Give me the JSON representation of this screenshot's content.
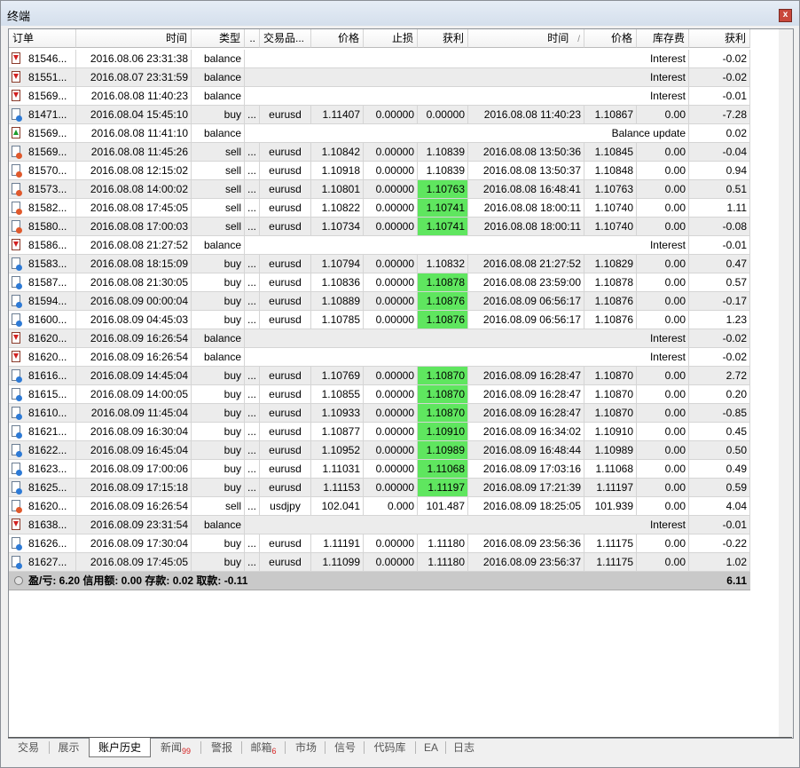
{
  "window": {
    "title": "终端",
    "close_label": "x"
  },
  "columns": [
    "订单",
    "时间",
    "类型",
    "..",
    "交易品...",
    "价格",
    "止损",
    "获利",
    "时间",
    "价格",
    "库存费",
    "获利"
  ],
  "sort_indicator": "/",
  "rows": [
    {
      "kind": "bal",
      "order": "81546...",
      "time": "2016.08.06 23:31:38",
      "type": "balance",
      "comment": "Interest",
      "profit": "-0.02"
    },
    {
      "kind": "bal",
      "order": "81551...",
      "time": "2016.08.07 23:31:59",
      "type": "balance",
      "comment": "Interest",
      "profit": "-0.02"
    },
    {
      "kind": "bal",
      "order": "81569...",
      "time": "2016.08.08 11:40:23",
      "type": "balance",
      "comment": "Interest",
      "profit": "-0.01"
    },
    {
      "kind": "trade",
      "order": "81471...",
      "time": "2016.08.04 15:45:10",
      "type": "buy",
      "dots": "...",
      "symbol": "eurusd",
      "price": "1.11407",
      "sl": "0.00000",
      "tp": "0.00000",
      "close_time": "2016.08.08 11:40:23",
      "close_price": "1.10867",
      "swap": "0.00",
      "profit": "-7.28"
    },
    {
      "kind": "bal-up",
      "order": "81569...",
      "time": "2016.08.08 11:41:10",
      "type": "balance",
      "comment": "Balance update",
      "profit": "0.02"
    },
    {
      "kind": "trade-sell",
      "order": "81569...",
      "time": "2016.08.08 11:45:26",
      "type": "sell",
      "dots": "...",
      "symbol": "eurusd",
      "price": "1.10842",
      "sl": "0.00000",
      "tp": "1.10839",
      "close_time": "2016.08.08 13:50:36",
      "close_price": "1.10845",
      "swap": "0.00",
      "profit": "-0.04"
    },
    {
      "kind": "trade-sell",
      "order": "81570...",
      "time": "2016.08.08 12:15:02",
      "type": "sell",
      "dots": "...",
      "symbol": "eurusd",
      "price": "1.10918",
      "sl": "0.00000",
      "tp": "1.10839",
      "close_time": "2016.08.08 13:50:37",
      "close_price": "1.10848",
      "swap": "0.00",
      "profit": "0.94"
    },
    {
      "kind": "trade-sell",
      "order": "81573...",
      "time": "2016.08.08 14:00:02",
      "type": "sell",
      "dots": "...",
      "symbol": "eurusd",
      "price": "1.10801",
      "sl": "0.00000",
      "tp": "1.10763",
      "tp_hit": true,
      "close_time": "2016.08.08 16:48:41",
      "close_price": "1.10763",
      "swap": "0.00",
      "profit": "0.51"
    },
    {
      "kind": "trade-sell",
      "order": "81582...",
      "time": "2016.08.08 17:45:05",
      "type": "sell",
      "dots": "...",
      "symbol": "eurusd",
      "price": "1.10822",
      "sl": "0.00000",
      "tp": "1.10741",
      "tp_hit": true,
      "close_time": "2016.08.08 18:00:11",
      "close_price": "1.10740",
      "swap": "0.00",
      "profit": "1.11"
    },
    {
      "kind": "trade-sell",
      "order": "81580...",
      "time": "2016.08.08 17:00:03",
      "type": "sell",
      "dots": "...",
      "symbol": "eurusd",
      "price": "1.10734",
      "sl": "0.00000",
      "tp": "1.10741",
      "tp_hit": true,
      "close_time": "2016.08.08 18:00:11",
      "close_price": "1.10740",
      "swap": "0.00",
      "profit": "-0.08"
    },
    {
      "kind": "bal",
      "order": "81586...",
      "time": "2016.08.08 21:27:52",
      "type": "balance",
      "comment": "Interest",
      "profit": "-0.01"
    },
    {
      "kind": "trade",
      "order": "81583...",
      "time": "2016.08.08 18:15:09",
      "type": "buy",
      "dots": "...",
      "symbol": "eurusd",
      "price": "1.10794",
      "sl": "0.00000",
      "tp": "1.10832",
      "close_time": "2016.08.08 21:27:52",
      "close_price": "1.10829",
      "swap": "0.00",
      "profit": "0.47"
    },
    {
      "kind": "trade",
      "order": "81587...",
      "time": "2016.08.08 21:30:05",
      "type": "buy",
      "dots": "...",
      "symbol": "eurusd",
      "price": "1.10836",
      "sl": "0.00000",
      "tp": "1.10878",
      "tp_hit": true,
      "close_time": "2016.08.08 23:59:00",
      "close_price": "1.10878",
      "swap": "0.00",
      "profit": "0.57"
    },
    {
      "kind": "trade",
      "order": "81594...",
      "time": "2016.08.09 00:00:04",
      "type": "buy",
      "dots": "...",
      "symbol": "eurusd",
      "price": "1.10889",
      "sl": "0.00000",
      "tp": "1.10876",
      "tp_hit": true,
      "close_time": "2016.08.09 06:56:17",
      "close_price": "1.10876",
      "swap": "0.00",
      "profit": "-0.17"
    },
    {
      "kind": "trade",
      "order": "81600...",
      "time": "2016.08.09 04:45:03",
      "type": "buy",
      "dots": "...",
      "symbol": "eurusd",
      "price": "1.10785",
      "sl": "0.00000",
      "tp": "1.10876",
      "tp_hit": true,
      "close_time": "2016.08.09 06:56:17",
      "close_price": "1.10876",
      "swap": "0.00",
      "profit": "1.23"
    },
    {
      "kind": "bal",
      "order": "81620...",
      "time": "2016.08.09 16:26:54",
      "type": "balance",
      "comment": "Interest",
      "profit": "-0.02"
    },
    {
      "kind": "bal",
      "order": "81620...",
      "time": "2016.08.09 16:26:54",
      "type": "balance",
      "comment": "Interest",
      "profit": "-0.02"
    },
    {
      "kind": "trade",
      "order": "81616...",
      "time": "2016.08.09 14:45:04",
      "type": "buy",
      "dots": "...",
      "symbol": "eurusd",
      "price": "1.10769",
      "sl": "0.00000",
      "tp": "1.10870",
      "tp_hit": true,
      "close_time": "2016.08.09 16:28:47",
      "close_price": "1.10870",
      "swap": "0.00",
      "profit": "2.72"
    },
    {
      "kind": "trade",
      "order": "81615...",
      "time": "2016.08.09 14:00:05",
      "type": "buy",
      "dots": "...",
      "symbol": "eurusd",
      "price": "1.10855",
      "sl": "0.00000",
      "tp": "1.10870",
      "tp_hit": true,
      "close_time": "2016.08.09 16:28:47",
      "close_price": "1.10870",
      "swap": "0.00",
      "profit": "0.20"
    },
    {
      "kind": "trade",
      "order": "81610...",
      "time": "2016.08.09 11:45:04",
      "type": "buy",
      "dots": "...",
      "symbol": "eurusd",
      "price": "1.10933",
      "sl": "0.00000",
      "tp": "1.10870",
      "tp_hit": true,
      "close_time": "2016.08.09 16:28:47",
      "close_price": "1.10870",
      "swap": "0.00",
      "profit": "-0.85"
    },
    {
      "kind": "trade",
      "order": "81621...",
      "time": "2016.08.09 16:30:04",
      "type": "buy",
      "dots": "...",
      "symbol": "eurusd",
      "price": "1.10877",
      "sl": "0.00000",
      "tp": "1.10910",
      "tp_hit": true,
      "close_time": "2016.08.09 16:34:02",
      "close_price": "1.10910",
      "swap": "0.00",
      "profit": "0.45"
    },
    {
      "kind": "trade",
      "order": "81622...",
      "time": "2016.08.09 16:45:04",
      "type": "buy",
      "dots": "...",
      "symbol": "eurusd",
      "price": "1.10952",
      "sl": "0.00000",
      "tp": "1.10989",
      "tp_hit": true,
      "close_time": "2016.08.09 16:48:44",
      "close_price": "1.10989",
      "swap": "0.00",
      "profit": "0.50"
    },
    {
      "kind": "trade",
      "order": "81623...",
      "time": "2016.08.09 17:00:06",
      "type": "buy",
      "dots": "...",
      "symbol": "eurusd",
      "price": "1.11031",
      "sl": "0.00000",
      "tp": "1.11068",
      "tp_hit": true,
      "close_time": "2016.08.09 17:03:16",
      "close_price": "1.11068",
      "swap": "0.00",
      "profit": "0.49"
    },
    {
      "kind": "trade",
      "order": "81625...",
      "time": "2016.08.09 17:15:18",
      "type": "buy",
      "dots": "...",
      "symbol": "eurusd",
      "price": "1.11153",
      "sl": "0.00000",
      "tp": "1.11197",
      "tp_hit": true,
      "close_time": "2016.08.09 17:21:39",
      "close_price": "1.11197",
      "swap": "0.00",
      "profit": "0.59"
    },
    {
      "kind": "trade-sell",
      "order": "81620...",
      "time": "2016.08.09 16:26:54",
      "type": "sell",
      "dots": "...",
      "symbol": "usdjpy",
      "price": "102.041",
      "sl": "0.000",
      "tp": "101.487",
      "close_time": "2016.08.09 18:25:05",
      "close_price": "101.939",
      "swap": "0.00",
      "profit": "4.04"
    },
    {
      "kind": "bal",
      "order": "81638...",
      "time": "2016.08.09 23:31:54",
      "type": "balance",
      "comment": "Interest",
      "profit": "-0.01"
    },
    {
      "kind": "trade",
      "order": "81626...",
      "time": "2016.08.09 17:30:04",
      "type": "buy",
      "dots": "...",
      "symbol": "eurusd",
      "price": "1.11191",
      "sl": "0.00000",
      "tp": "1.11180",
      "close_time": "2016.08.09 23:56:36",
      "close_price": "1.11175",
      "swap": "0.00",
      "profit": "-0.22"
    },
    {
      "kind": "trade",
      "order": "81627...",
      "time": "2016.08.09 17:45:05",
      "type": "buy",
      "dots": "...",
      "symbol": "eurusd",
      "price": "1.11099",
      "sl": "0.00000",
      "tp": "1.11180",
      "close_time": "2016.08.09 23:56:37",
      "close_price": "1.11175",
      "swap": "0.00",
      "profit": "1.02"
    }
  ],
  "summary": {
    "text": "盈/亏: 6.20  信用额: 0.00  存款: 0.02  取款: -0.11",
    "total": "6.11"
  },
  "tabs": [
    {
      "label": "交易"
    },
    {
      "label": "展示"
    },
    {
      "label": "账户历史",
      "active": true
    },
    {
      "label": "新闻",
      "badge": "99"
    },
    {
      "label": "警报"
    },
    {
      "label": "邮箱",
      "badge": "6"
    },
    {
      "label": "市场"
    },
    {
      "label": "信号"
    },
    {
      "label": "代码库"
    },
    {
      "label": "EA"
    },
    {
      "label": "日志"
    }
  ],
  "colors": {
    "tp_hit": "#5fe65f",
    "alt_row": "#ececec",
    "summary_bg": "#c9c9c9",
    "badge": "#d62020"
  }
}
